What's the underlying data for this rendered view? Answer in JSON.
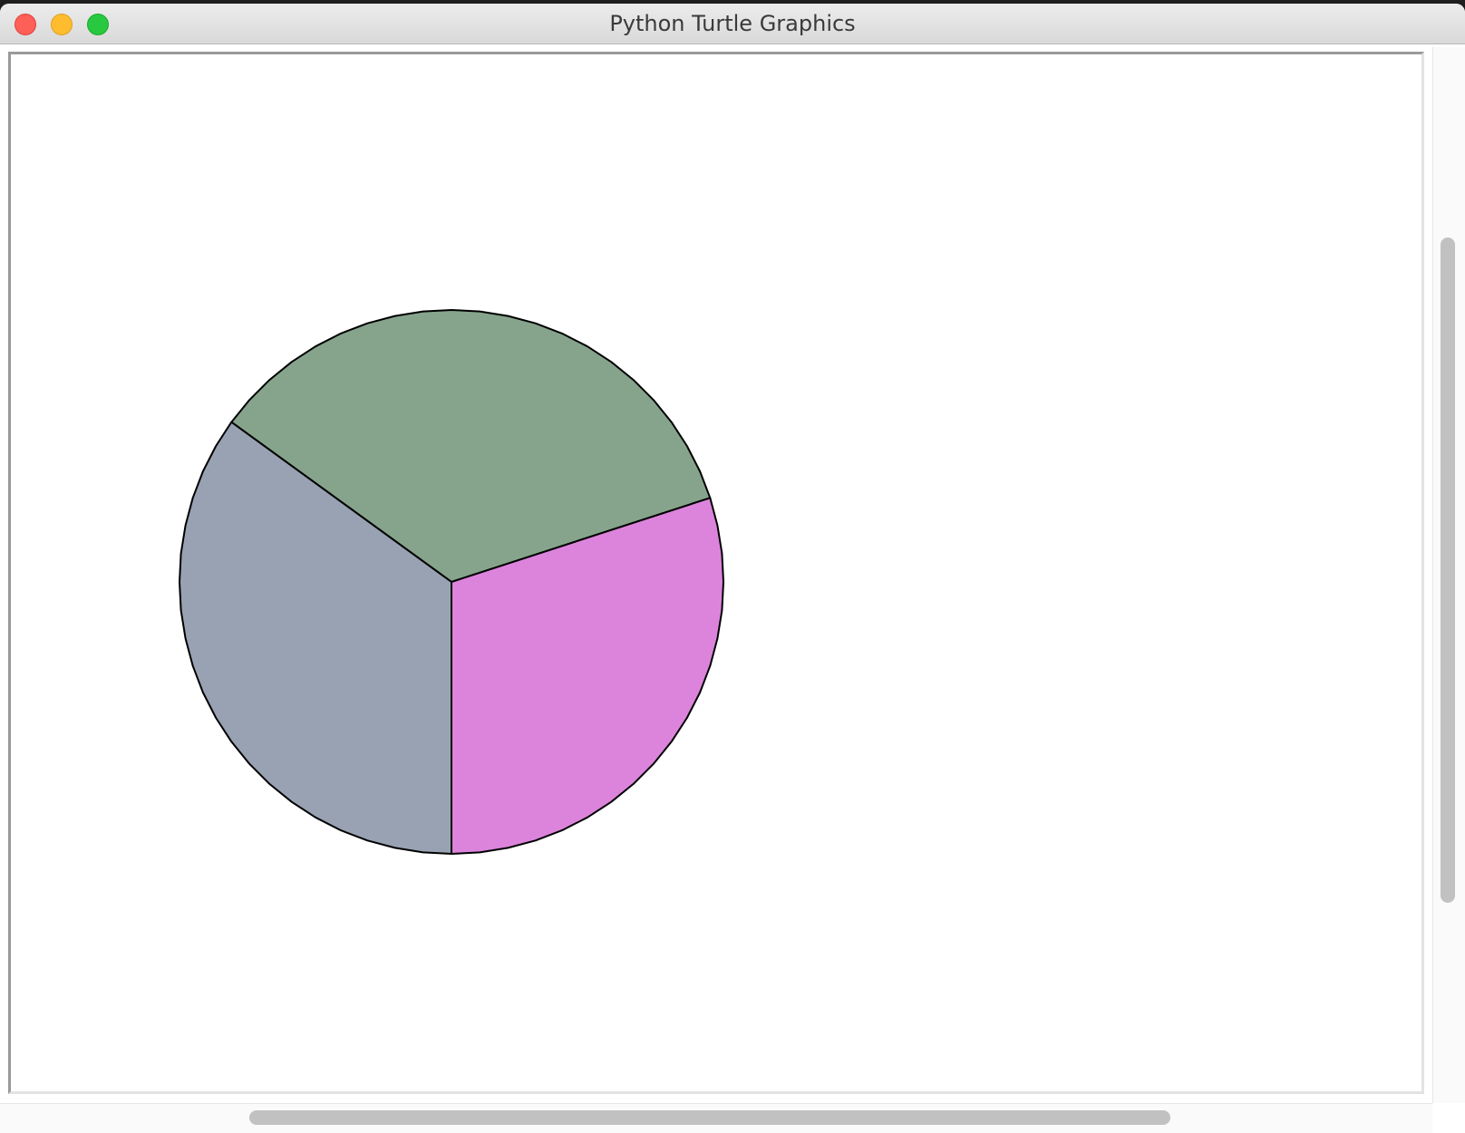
{
  "window": {
    "title": "Python Turtle Graphics"
  },
  "drawing": {
    "shape": "pie",
    "stroke_color": "#000000",
    "slices": [
      {
        "name": "green-slice",
        "color": "#86a48c",
        "from_deg": 18,
        "to_deg": 144
      },
      {
        "name": "gray-slice",
        "color": "#98a2b2",
        "from_deg": 144,
        "to_deg": 270
      },
      {
        "name": "pink-slice",
        "color": "#dc84dc",
        "from_deg": 270,
        "to_deg": 378
      }
    ]
  }
}
